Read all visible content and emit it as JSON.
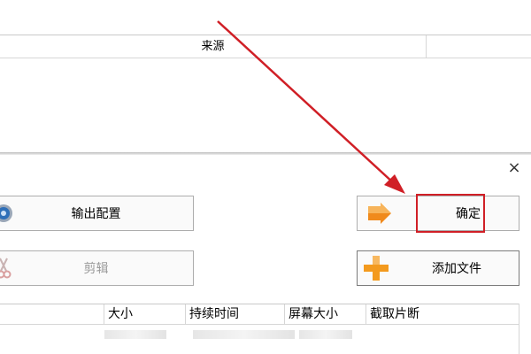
{
  "top_list": {
    "columns": [
      "来源"
    ]
  },
  "dialog": {
    "close_glyph": "×",
    "buttons": {
      "export_settings": "输出配置",
      "edit": "剪辑",
      "confirm": "确定",
      "add_file": "添加文件"
    },
    "file_list": {
      "columns": [
        "",
        "大小",
        "持续时间",
        "屏幕大小",
        "截取片断"
      ]
    }
  },
  "icons": {
    "export_settings": "gear-icon",
    "edit": "scissors-icon",
    "confirm": "arrow-right-icon",
    "add_file": "plus-icon"
  },
  "colors": {
    "annotation_red": "#d01f26",
    "plus_orange": "#f39a1e",
    "arrow_orange": "#f08a1c",
    "gear_blue": "#2f6fb8"
  }
}
